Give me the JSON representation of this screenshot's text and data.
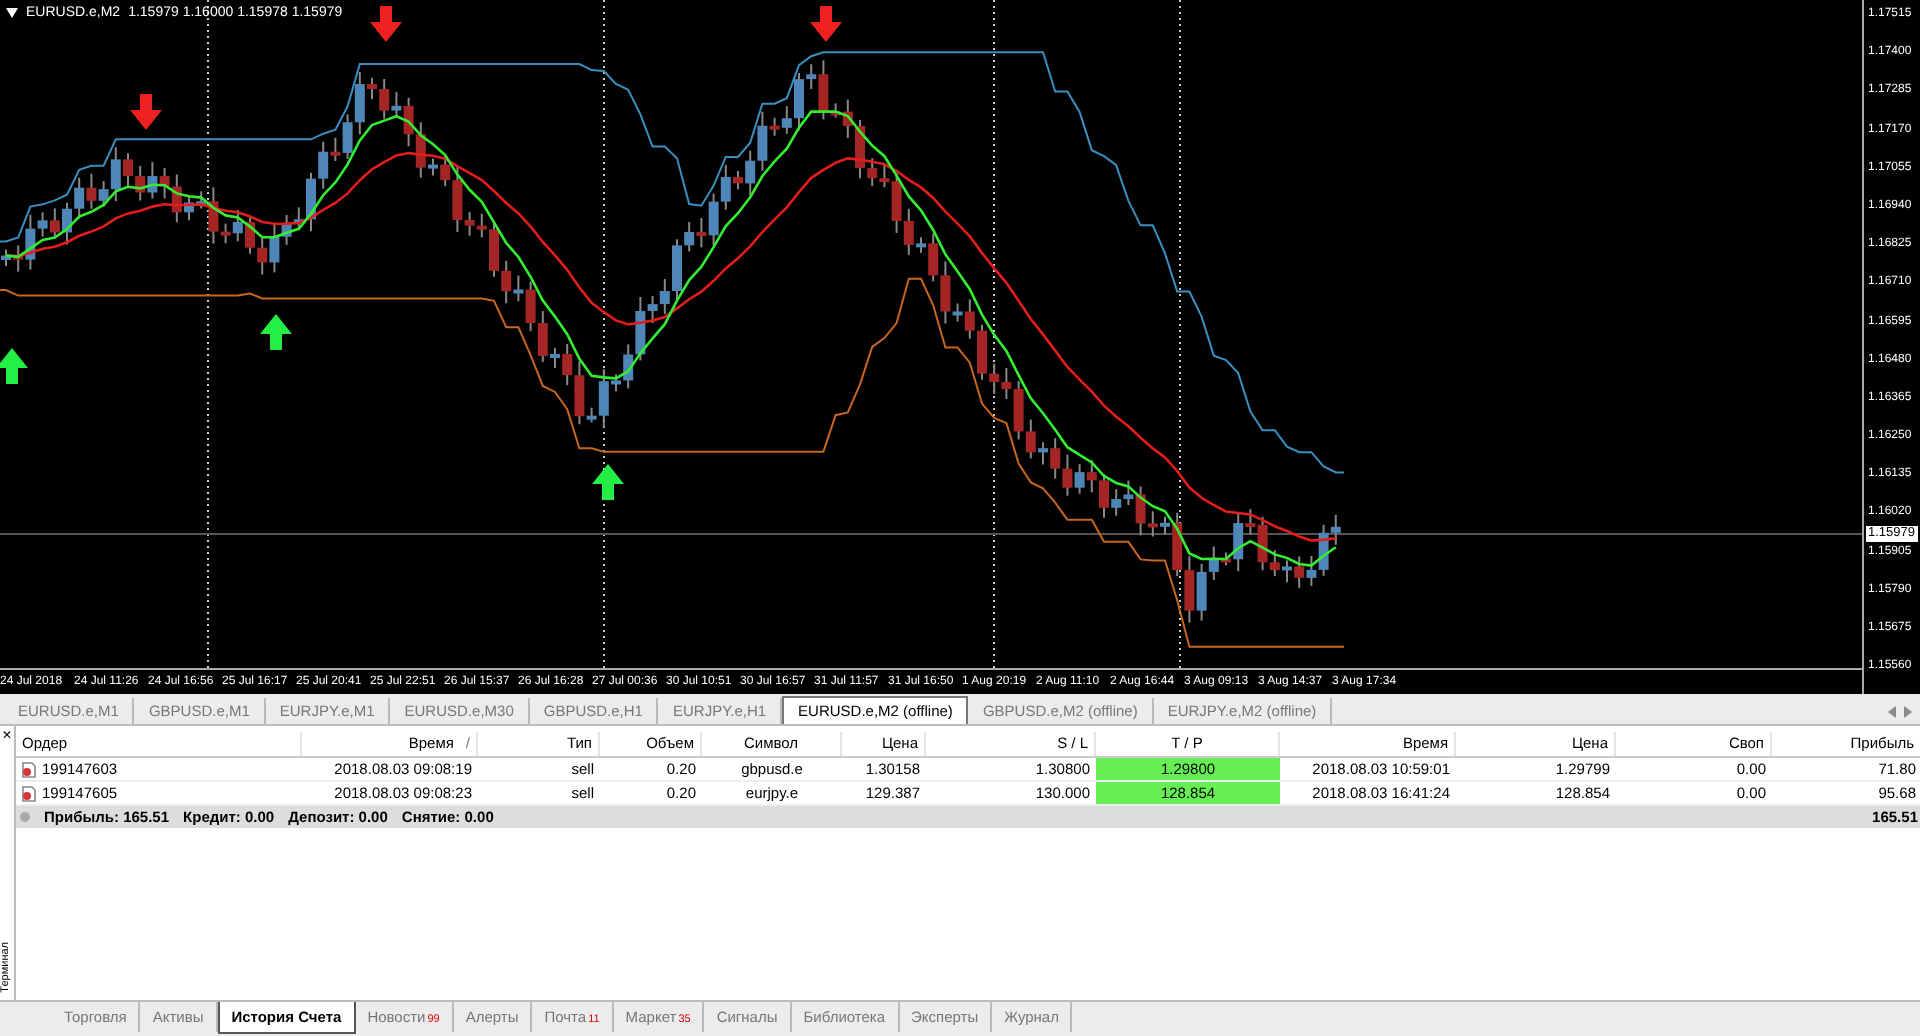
{
  "chart": {
    "symbol": "EURUSD.e,M2",
    "ohlc": "1.15979 1.16000 1.15978 1.15979",
    "price_ticks": [
      "1.17515",
      "1.17400",
      "1.17285",
      "1.17170",
      "1.17055",
      "1.16940",
      "1.16825",
      "1.16710",
      "1.16595",
      "1.16480",
      "1.16365",
      "1.16250",
      "1.16135",
      "1.16020",
      "1.15905",
      "1.15790",
      "1.15675",
      "1.15560"
    ],
    "current_price": "1.15979",
    "time_ticks": [
      "24 Jul 2018",
      "24 Jul 11:26",
      "24 Jul 16:56",
      "25 Jul 16:17",
      "25 Jul 20:41",
      "25 Jul 22:51",
      "26 Jul 15:37",
      "26 Jul 16:28",
      "27 Jul 00:36",
      "30 Jul 10:51",
      "30 Jul 16:57",
      "31 Jul 11:57",
      "31 Jul 16:50",
      "1 Aug 20:19",
      "2 Aug 11:10",
      "2 Aug 16:44",
      "3 Aug 09:13",
      "3 Aug 14:37",
      "3 Aug 17:34"
    ]
  },
  "chart_tabs": [
    {
      "label": "EURUSD.e,M1",
      "selected": false
    },
    {
      "label": "GBPUSD.e,M1",
      "selected": false
    },
    {
      "label": "EURJPY.e,M1",
      "selected": false
    },
    {
      "label": "EURUSD.e,M30",
      "selected": false
    },
    {
      "label": "GBPUSD.e,H1",
      "selected": false
    },
    {
      "label": "EURJPY.e,H1",
      "selected": false
    },
    {
      "label": "EURUSD.e,M2 (offline)",
      "selected": true
    },
    {
      "label": "GBPUSD.e,M2 (offline)",
      "selected": false
    },
    {
      "label": "EURJPY.e,M2 (offline)",
      "selected": false
    }
  ],
  "table": {
    "columns": [
      {
        "label": "Ордер"
      },
      {
        "label": "Время",
        "sort_mark": "/"
      },
      {
        "label": "Тип"
      },
      {
        "label": "Объем"
      },
      {
        "label": "Символ"
      },
      {
        "label": "Цена"
      },
      {
        "label": "S / L"
      },
      {
        "label": "T / P"
      },
      {
        "label": "Время"
      },
      {
        "label": "Цена"
      },
      {
        "label": "Своп"
      },
      {
        "label": "Прибыль"
      }
    ],
    "rows": [
      {
        "cells": [
          "199147603",
          "2018.08.03 09:08:19",
          "sell",
          "0.20",
          "gbpusd.e",
          "1.30158",
          "1.30800",
          "1.29800",
          "2018.08.03 10:59:01",
          "1.29799",
          "0.00",
          "71.80"
        ]
      },
      {
        "cells": [
          "199147605",
          "2018.08.03 09:08:23",
          "sell",
          "0.20",
          "eurjpy.e",
          "129.387",
          "130.000",
          "128.854",
          "2018.08.03 16:41:24",
          "128.854",
          "0.00",
          "95.68"
        ]
      }
    ],
    "summary": {
      "items": [
        "Прибыль: 165.51",
        "Кредит: 0.00",
        "Депозит: 0.00",
        "Снятие: 0.00"
      ],
      "total": "165.51"
    }
  },
  "terminal_label": "Терминал",
  "close_glyph": "×",
  "bottom_tabs": [
    {
      "label": "Торговля",
      "selected": false
    },
    {
      "label": "Активы",
      "selected": false
    },
    {
      "label": "История Счета",
      "selected": true
    },
    {
      "label": "Новости",
      "badge": "99",
      "selected": false
    },
    {
      "label": "Алерты",
      "selected": false
    },
    {
      "label": "Почта",
      "badge": "11",
      "selected": false
    },
    {
      "label": "Маркет",
      "badge": "35",
      "selected": false
    },
    {
      "label": "Сигналы",
      "selected": false
    },
    {
      "label": "Библиотека",
      "selected": false
    },
    {
      "label": "Эксперты",
      "selected": false
    },
    {
      "label": "Журнал",
      "selected": false
    }
  ]
}
